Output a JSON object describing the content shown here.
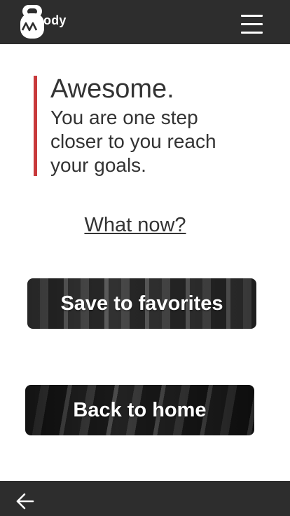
{
  "header": {
    "logo_text": "ody",
    "logo_icon": "kettlebell-logo-icon",
    "menu_icon": "hamburger-menu-icon"
  },
  "main": {
    "title": "Awesome.",
    "subtitle": "You are one step closer to you reach your goals.",
    "what_now_link": "What now?",
    "save_button_label": "Save to favorites",
    "home_button_label": "Back to home"
  },
  "footer": {
    "back_icon": "arrow-left-icon"
  },
  "colors": {
    "bar_background": "#2d2d2d",
    "accent": "#c8393b",
    "text": "#333333"
  }
}
